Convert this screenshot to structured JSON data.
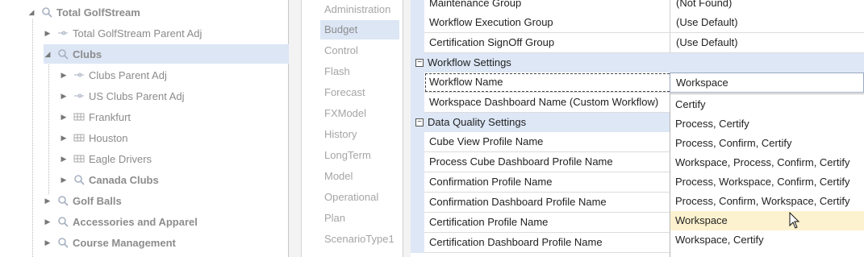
{
  "tree": {
    "items": [
      {
        "label": "Total GolfStream",
        "bold": true,
        "icon": "magnifier-icon",
        "expanded": true
      },
      {
        "label": "Total GolfStream Parent Adj",
        "bold": false,
        "icon": "adjustment-icon"
      },
      {
        "label": "Clubs",
        "bold": true,
        "icon": "magnifier-icon",
        "expanded": true
      },
      {
        "label": "Clubs Parent Adj",
        "bold": false,
        "icon": "adjustment-icon"
      },
      {
        "label": "US Clubs Parent Adj",
        "bold": false,
        "icon": "adjustment-icon"
      },
      {
        "label": "Frankfurt",
        "bold": false,
        "icon": "grid-icon"
      },
      {
        "label": "Houston",
        "bold": false,
        "icon": "grid-icon"
      },
      {
        "label": "Eagle Drivers",
        "bold": false,
        "icon": "grid-icon"
      },
      {
        "label": "Canada Clubs",
        "bold": true,
        "icon": "magnifier-icon"
      },
      {
        "label": "Golf Balls",
        "bold": true,
        "icon": "magnifier-icon"
      },
      {
        "label": "Accessories and Apparel",
        "bold": true,
        "icon": "magnifier-icon"
      },
      {
        "label": "Course Management",
        "bold": true,
        "icon": "magnifier-icon"
      }
    ],
    "selected": "Clubs"
  },
  "scenarios": {
    "items": [
      "Administration",
      "Budget",
      "Control",
      "Flash",
      "Forecast",
      "FXModel",
      "History",
      "LongTerm",
      "Model",
      "Operational",
      "Plan",
      "ScenarioType1"
    ],
    "selected": "Budget"
  },
  "grid": {
    "rows": [
      {
        "name": "Maintenance Group",
        "value": "(Not Found)"
      },
      {
        "name": "Workflow Execution Group",
        "value": "(Use Default)"
      },
      {
        "name": "Certification SignOff Group",
        "value": "(Use Default)"
      }
    ],
    "category_workflow": "Workflow Settings",
    "workflow_rows": [
      {
        "name": "Workflow Name",
        "value": "Workspace"
      },
      {
        "name": "Workspace Dashboard Name (Custom Workflow)",
        "value": ""
      }
    ],
    "category_dq": "Data Quality Settings",
    "dq_rows": [
      {
        "name": "Cube View Profile Name",
        "value": ""
      },
      {
        "name": "Process Cube Dashboard Profile Name",
        "value": ""
      },
      {
        "name": "Confirmation Profile Name",
        "value": ""
      },
      {
        "name": "Confirmation Dashboard Profile Name",
        "value": ""
      },
      {
        "name": "Certification Profile Name",
        "value": ""
      },
      {
        "name": "Certification Dashboard Profile Name",
        "value": ""
      }
    ]
  },
  "dropdown": {
    "options": [
      "Certify",
      "Process, Certify",
      "Process, Confirm, Certify",
      "Workspace, Process, Confirm, Certify",
      "Process, Workspace, Confirm, Certify",
      "Process, Confirm, Workspace, Certify",
      "Workspace",
      "Workspace, Certify"
    ],
    "hovered": "Workspace"
  },
  "colors": {
    "selection": "#dce6f5",
    "category": "#dde7f6",
    "hover": "#fdf2cf"
  }
}
